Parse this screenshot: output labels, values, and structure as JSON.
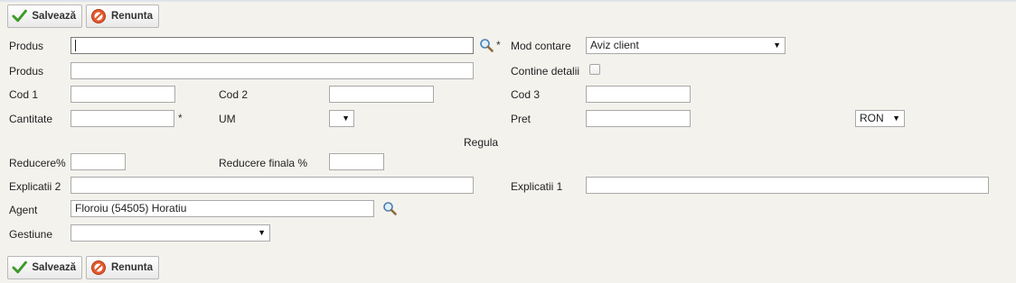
{
  "toolbar": {
    "save_label": "Salvează",
    "cancel_label": "Renunta"
  },
  "form": {
    "produs_label": "Produs",
    "produs_value": "",
    "produs2_label": "Produs",
    "produs2_value": "",
    "mod_contare_label": "Mod contare",
    "mod_contare_value": "Aviz client",
    "contine_detalii_label": "Contine detalii",
    "contine_detalii_checked": false,
    "cod1_label": "Cod 1",
    "cod2_label": "Cod 2",
    "cod3_label": "Cod 3",
    "cantitate_label": "Cantitate",
    "um_label": "UM",
    "um_value": "",
    "pret_label": "Pret",
    "currency_value": "RON",
    "regula_label": "Regula",
    "reducere_label": "Reducere%",
    "reducere_finala_label": "Reducere finala %",
    "explicatii2_label": "Explicatii 2",
    "explicatii1_label": "Explicatii 1",
    "agent_label": "Agent",
    "agent_value": "Floroiu (54505) Horatiu",
    "gestiune_label": "Gestiune",
    "gestiune_value": "",
    "required_marker": "*"
  },
  "icons": {
    "save": "checkmark-icon",
    "cancel": "cancel-icon",
    "search": "magnifier-icon",
    "dropdown": "triangle-down-icon"
  },
  "colors": {
    "background": "#f4f2ed",
    "check_green": "#3c9a2a",
    "cancel_red": "#d84a2a"
  }
}
